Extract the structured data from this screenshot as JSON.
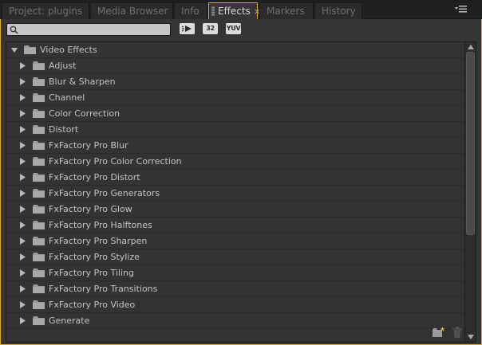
{
  "tabs": [
    {
      "label": "Project: plugins",
      "active": false
    },
    {
      "label": "Media Browser",
      "active": false
    },
    {
      "label": "Info",
      "active": false
    },
    {
      "label": "Effects",
      "active": true
    },
    {
      "label": "Markers",
      "active": false
    },
    {
      "label": "History",
      "active": false
    }
  ],
  "tab_close_glyph": "×",
  "search": {
    "value": "",
    "placeholder": ""
  },
  "toolbar": {
    "accelerated_label": "",
    "bit32_label": "32",
    "yuv_label": "YUV"
  },
  "tree": {
    "root": {
      "label": "Video Effects",
      "expanded": true
    },
    "items": [
      "Adjust",
      "Blur & Sharpen",
      "Channel",
      "Color Correction",
      "Distort",
      "FxFactory Pro Blur",
      "FxFactory Pro Color Correction",
      "FxFactory Pro Distort",
      "FxFactory Pro Generators",
      "FxFactory Pro Glow",
      "FxFactory Pro Halftones",
      "FxFactory Pro Sharpen",
      "FxFactory Pro Stylize",
      "FxFactory Pro Tiling",
      "FxFactory Pro Transitions",
      "FxFactory Pro Video",
      "Generate"
    ]
  },
  "icons": {
    "search": "search-icon",
    "folder": "folder-icon",
    "collapsed": "triangle-right-icon",
    "expanded": "triangle-down-icon",
    "new_bin": "new-custom-bin-icon",
    "delete": "trash-icon",
    "panel_menu": "panel-menu-icon"
  },
  "colors": {
    "accent": "#d6a93a",
    "panel_bg": "#353535",
    "text": "#c3c3c3"
  }
}
